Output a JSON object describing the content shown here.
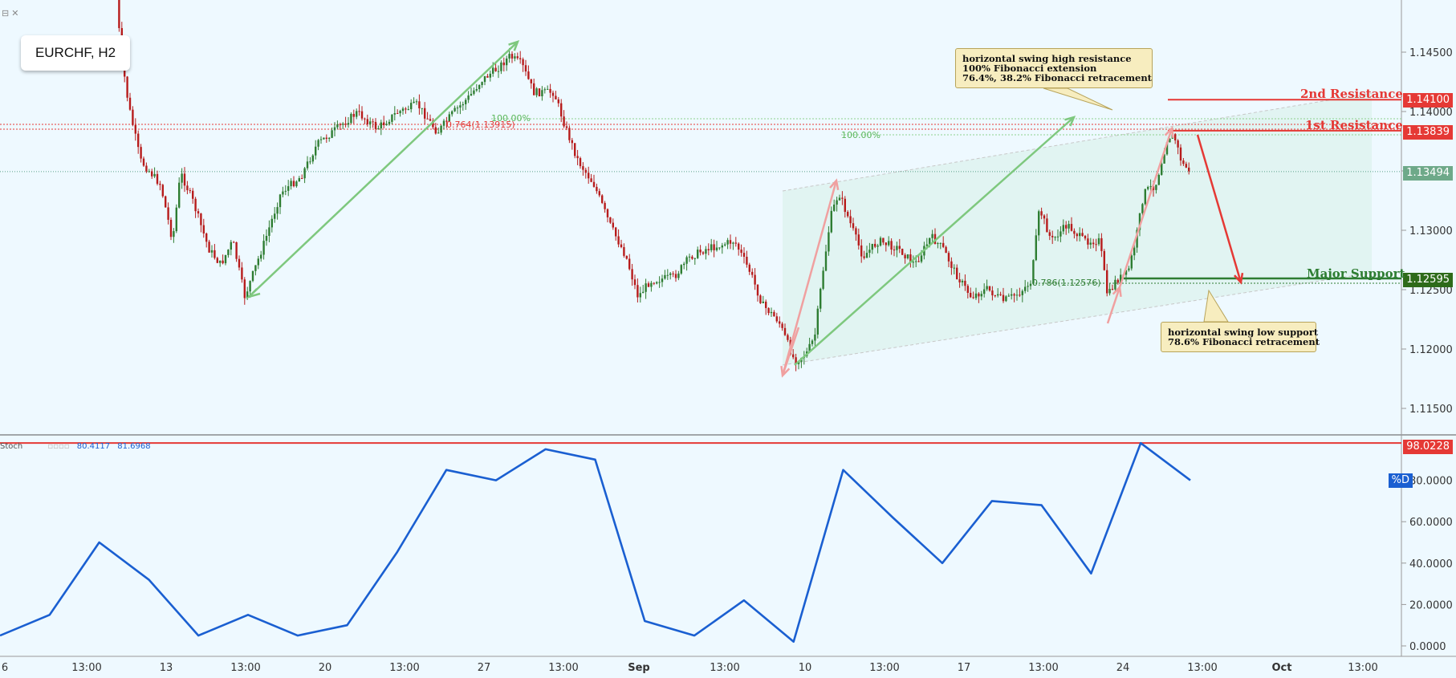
{
  "header": {
    "symbol_label": "EURCHF, H2"
  },
  "colors": {
    "background": "#eef9ff",
    "up": "#2e7d32",
    "down": "#b71c1c",
    "resistance": "#e53935",
    "support": "#2e7d32",
    "stoch": "#1a5fd1",
    "green_arrow": "#7ec87e",
    "pink_arrow": "#f0a0a0"
  },
  "price_axis": {
    "ticks": [
      "1.14500",
      "1.14000",
      "1.13500",
      "1.13000",
      "1.12500",
      "1.12000",
      "1.11500"
    ],
    "tick_values": [
      1.145,
      1.14,
      1.135,
      1.13,
      1.125,
      1.12,
      1.115
    ]
  },
  "time_axis": {
    "ticks": [
      "6",
      "13:00",
      "13",
      "13:00",
      "20",
      "13:00",
      "27",
      "13:00",
      "Sep",
      "13:00",
      "10",
      "13:00",
      "17",
      "13:00",
      "24",
      "13:00",
      "Oct",
      "13:00"
    ]
  },
  "levels": {
    "second_resistance": {
      "label": "2nd Resistance",
      "price": "1.14100",
      "value": 1.141
    },
    "first_resistance": {
      "label": "1st Resistance",
      "price": "1.13839",
      "value": 1.13839
    },
    "current": {
      "price": "1.13494",
      "value": 1.13494
    },
    "major_support": {
      "label": "Major Support",
      "price": "1.12595",
      "value": 1.12595
    }
  },
  "fib_labels": {
    "top_a": "100.00%",
    "top_b": "100.00%",
    "top_c": "0.764(1.13915)",
    "support_fib": "0.786(1.12576)"
  },
  "notes": {
    "resistance_note": [
      "horizontal swing high resistance",
      "100% Fibonacci extension",
      "76.4%, 38.2% Fibonacci retracement"
    ],
    "support_note": [
      "horizontal swing low support",
      "78.6% Fibonacci retracement"
    ]
  },
  "stoch": {
    "label": "Stoch",
    "value_k": "80.4117",
    "value_d": "81.6968",
    "legend": "%D",
    "level_label": "98.0228",
    "level_value": 98.0228,
    "ticks": [
      "80.0000",
      "60.0000",
      "40.0000",
      "20.0000",
      "0.0000"
    ],
    "tick_values": [
      80,
      60,
      40,
      20,
      0
    ]
  },
  "chart_data": [
    {
      "type": "line",
      "title": "EURCHF, H2",
      "x": [
        "6",
        "13",
        "20",
        "27",
        "Sep",
        "10",
        "17",
        "24",
        "Oct"
      ],
      "series": [
        {
          "values": [
            1.147,
            1.1305,
            1.1245,
            1.1453,
            1.1342,
            1.1188,
            1.1245,
            1.1382,
            1.1349
          ]
        }
      ],
      "ylim": [
        1.111,
        1.149
      ],
      "levels": [
        1.141,
        1.13839,
        1.13494,
        1.12595
      ],
      "grid": false
    },
    {
      "type": "line",
      "title": "Stoch",
      "series": [
        {
          "name": "%D",
          "values": [
            5,
            15,
            50,
            32,
            5,
            15,
            5,
            10,
            45,
            85,
            80,
            95,
            90,
            12,
            5,
            22,
            2,
            85,
            62,
            40,
            70,
            68,
            35,
            98,
            80
          ]
        }
      ],
      "ylim": [
        0,
        100
      ]
    }
  ]
}
